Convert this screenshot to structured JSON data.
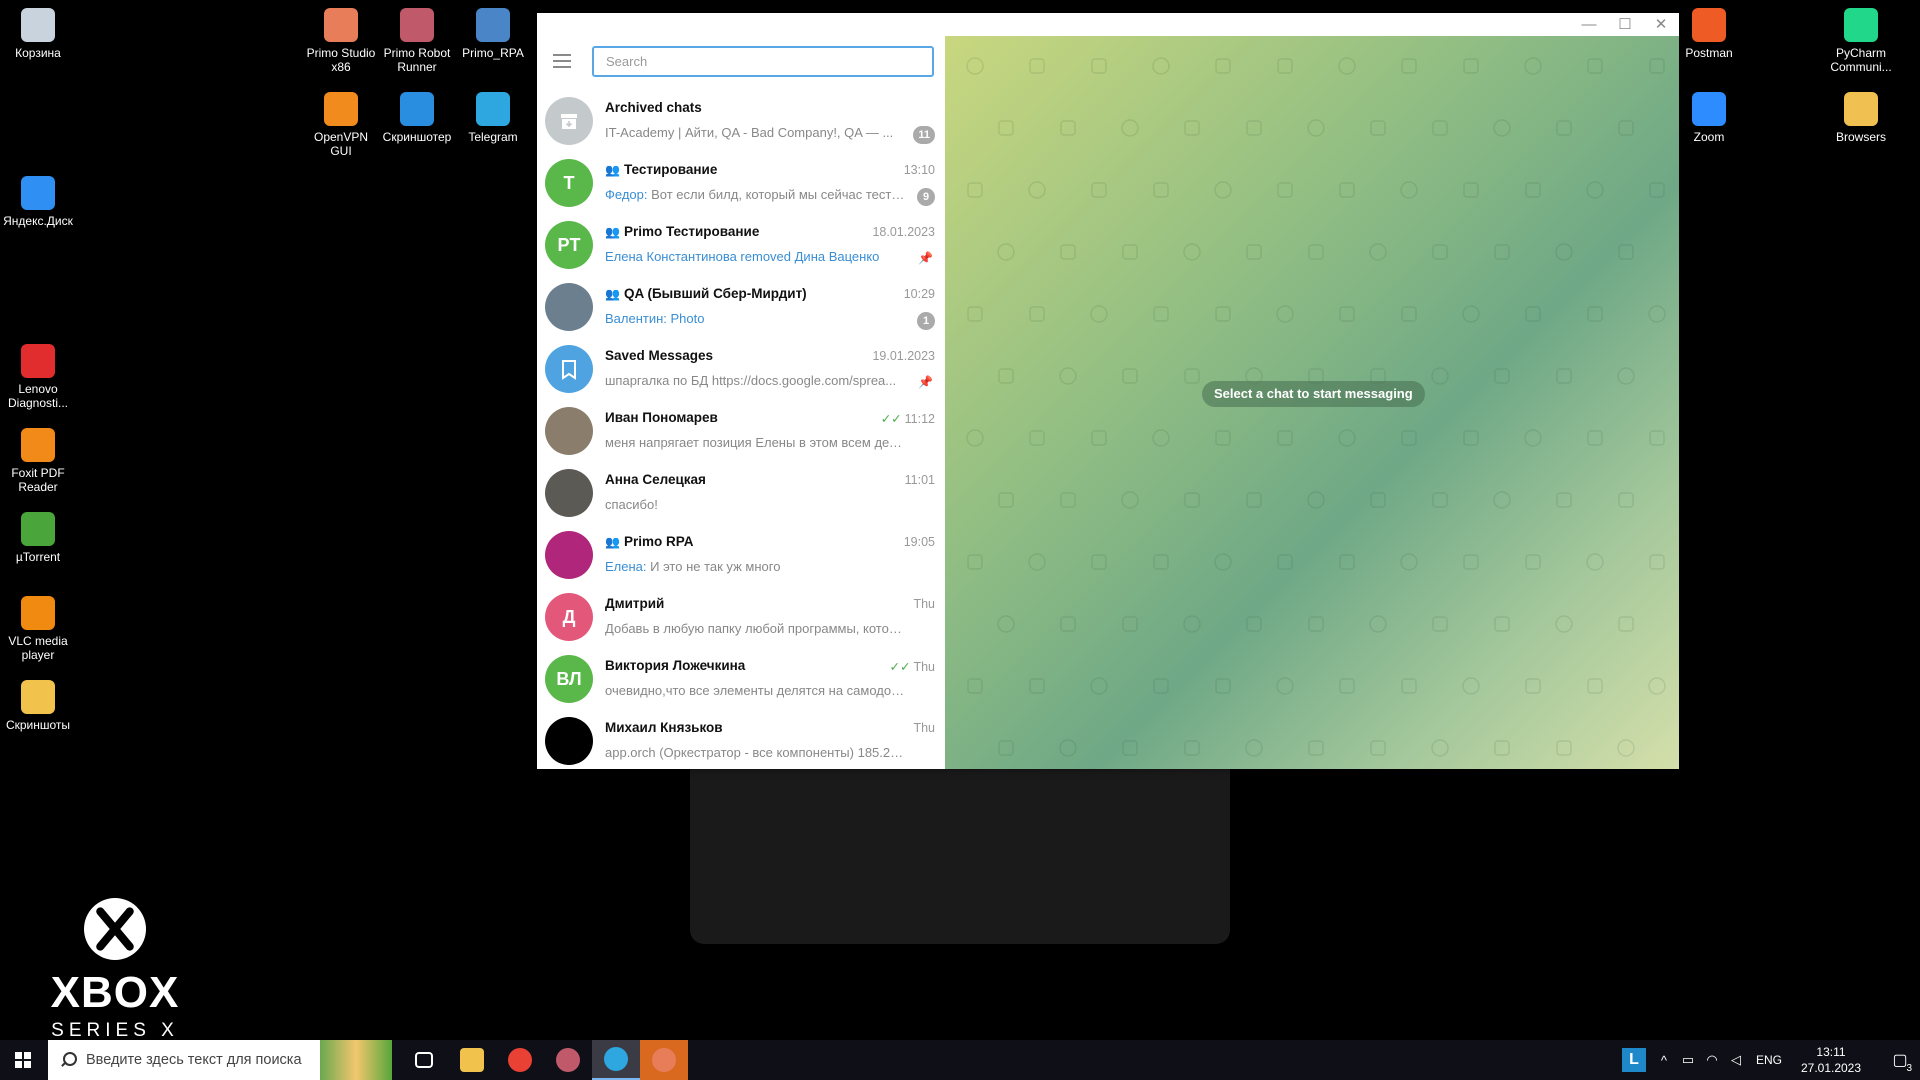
{
  "desktop_icons": [
    {
      "label": "Корзина",
      "icon": "recycle-bin-icon",
      "color": "#c9d3dd"
    },
    {
      "label": "Яндекс.Диск",
      "icon": "yandex-disk-icon",
      "color": "#2f8ff2"
    },
    {
      "label": "Lenovo Diagnosti...",
      "icon": "lenovo-diagnostics-icon",
      "color": "#e12d2d"
    },
    {
      "label": "Foxit PDF Reader",
      "icon": "foxit-pdf-icon",
      "color": "#f28a1a"
    },
    {
      "label": "µTorrent",
      "icon": "utorrent-icon",
      "color": "#4aa63a"
    },
    {
      "label": "VLC media player",
      "icon": "vlc-icon",
      "color": "#f08a10"
    },
    {
      "label": "Скриншоты",
      "icon": "folder-icon",
      "color": "#f1c34c"
    },
    {
      "label": "Primo Studio x86",
      "icon": "primo-studio-icon",
      "color": "#e87d5a"
    },
    {
      "label": "Primo Robot Runner",
      "icon": "primo-robot-icon",
      "color": "#c05a6a"
    },
    {
      "label": "Primo_RPA",
      "icon": "primo-rpa-icon",
      "color": "#4a86c7"
    },
    {
      "label": "OpenVPN GUI",
      "icon": "openvpn-icon",
      "color": "#f28b1d"
    },
    {
      "label": "Скриншотер",
      "icon": "screenshoter-icon",
      "color": "#2a8ee0"
    },
    {
      "label": "Telegram",
      "icon": "telegram-icon",
      "color": "#2ea6e0"
    },
    {
      "label": "Postman",
      "icon": "postman-icon",
      "color": "#ef5b25"
    },
    {
      "label": "PyCharm Communi...",
      "icon": "pycharm-icon",
      "color": "#21d789"
    },
    {
      "label": "Zoom",
      "icon": "zoom-icon",
      "color": "#2d8cff"
    },
    {
      "label": "Browsers",
      "icon": "browsers-folder-icon",
      "color": "#f0c050"
    }
  ],
  "xbox": {
    "title": "XBOX",
    "subtitle": "SERIES X"
  },
  "telegram": {
    "search_placeholder": "Search",
    "window_buttons": {
      "minimize": "—",
      "maximize": "☐",
      "close": "✕"
    },
    "chats": [
      {
        "avatar_text": "",
        "avatar_color": "#c4c9cc",
        "avatar_icon": "archive-icon",
        "name": "Archived chats",
        "is_group": false,
        "time": "",
        "sender": "",
        "preview": "IT-Academy | Айти, QA - Bad Company!, QA — ...",
        "badge": "11",
        "pinned": false,
        "read_check": false
      },
      {
        "avatar_text": "Т",
        "avatar_color": "#5ab84a",
        "avatar_icon": "",
        "name": "Тестирование",
        "is_group": true,
        "time": "13:10",
        "sender": "Федор: ",
        "preview": "Вот если билд, который мы сейчас тести...",
        "badge": "9",
        "pinned": false,
        "read_check": false
      },
      {
        "avatar_text": "PT",
        "avatar_color": "#5ab84a",
        "avatar_icon": "",
        "name": "Primo Тестирование",
        "is_group": true,
        "time": "18.01.2023",
        "sender": "",
        "preview": "Елена Константинова removed Дина Ваценко",
        "badge": "",
        "pinned": true,
        "read_check": false,
        "preview_blue": true
      },
      {
        "avatar_text": "",
        "avatar_color": "#6b7f8f",
        "avatar_icon": "photo-avatar",
        "name": "QA (Бывший Сбер-Мирдит)",
        "is_group": true,
        "time": "10:29",
        "sender": "Валентин: ",
        "preview": "Photo",
        "badge": "1",
        "pinned": false,
        "read_check": false,
        "preview_blue": true
      },
      {
        "avatar_text": "",
        "avatar_color": "#4fa3e0",
        "avatar_icon": "bookmark-icon",
        "name": "Saved Messages",
        "is_group": false,
        "time": "19.01.2023",
        "sender": "",
        "preview": "шпаргалка по БД https://docs.google.com/sprea...",
        "badge": "",
        "pinned": true,
        "read_check": false
      },
      {
        "avatar_text": "",
        "avatar_color": "#8a7d6b",
        "avatar_icon": "photo-avatar",
        "name": "Иван Пономарев",
        "is_group": false,
        "time": "11:12",
        "sender": "",
        "preview": "меня напрягает позиция Елены в этом всем деле.Та...",
        "badge": "",
        "pinned": false,
        "read_check": true
      },
      {
        "avatar_text": "",
        "avatar_color": "#5c5a55",
        "avatar_icon": "photo-avatar",
        "name": "Анна Селецкая",
        "is_group": false,
        "time": "11:01",
        "sender": "",
        "preview": "спасибо!",
        "badge": "",
        "pinned": false,
        "read_check": false
      },
      {
        "avatar_text": "",
        "avatar_color": "#b0267a",
        "avatar_icon": "photo-avatar",
        "name": "Primo RPA",
        "is_group": true,
        "time": "19:05",
        "sender": "Елена: ",
        "preview": "И это не так уж много",
        "badge": "",
        "pinned": false,
        "read_check": false
      },
      {
        "avatar_text": "Д",
        "avatar_color": "#e3587a",
        "avatar_icon": "",
        "name": "Дмитрий",
        "is_group": false,
        "time": "Thu",
        "sender": "",
        "preview": "Добавь в любую папку любой программы, котора...",
        "badge": "",
        "pinned": false,
        "read_check": false
      },
      {
        "avatar_text": "ВЛ",
        "avatar_color": "#5ab84a",
        "avatar_icon": "",
        "name": "Виктория Ложечкина",
        "is_group": false,
        "time": "Thu",
        "sender": "",
        "preview": "очевидно,что все элементы делятся на самодостат...",
        "badge": "",
        "pinned": false,
        "read_check": true
      },
      {
        "avatar_text": "",
        "avatar_color": "#000000",
        "avatar_icon": "photo-avatar",
        "name": "Михаил Князьков",
        "is_group": false,
        "time": "Thu",
        "sender": "",
        "preview": "app.orch (Оркестратор - все компоненты) 185.230.1...",
        "badge": "",
        "pinned": false,
        "read_check": false
      }
    ],
    "empty_state": "Select a chat to start messaging"
  },
  "taskbar": {
    "search_placeholder": "Введите здесь текст для поиска",
    "apps": [
      {
        "icon": "task-view-icon",
        "color": "#ffffff"
      },
      {
        "icon": "file-explorer-icon",
        "color": "#f1c34c"
      },
      {
        "icon": "chrome-icon",
        "color": "#e94235"
      },
      {
        "icon": "primo-icon",
        "color": "#c05a6a"
      },
      {
        "icon": "telegram-icon",
        "color": "#2ea6e0"
      },
      {
        "icon": "primo-studio-icon",
        "color": "#e87d5a"
      }
    ],
    "tray_letter": "L",
    "tray_caret": "^",
    "language": "ENG",
    "time": "13:11",
    "date": "27.01.2023",
    "notification_count": "3"
  }
}
